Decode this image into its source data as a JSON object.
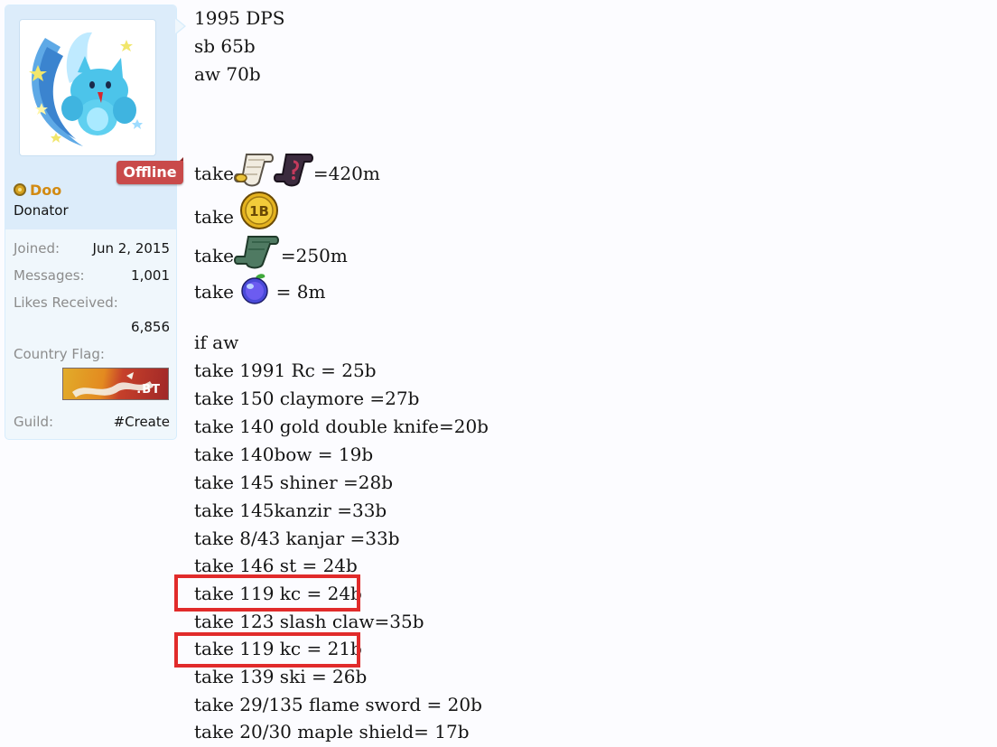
{
  "user": {
    "name": "Doo",
    "title": "Donator",
    "status": "Offline",
    "stats": [
      {
        "label": "Joined:",
        "value": "Jun 2, 2015"
      },
      {
        "label": "Messages:",
        "value": "1,001"
      },
      {
        "label": "Likes Received:",
        "value": "6,856"
      },
      {
        "label": "Country Flag:",
        "value": ".BT"
      },
      {
        "label": "Guild:",
        "value": "#Create"
      }
    ]
  },
  "post": {
    "header_lines": [
      "1995 DPS",
      "sb 65b",
      "aw 70b"
    ],
    "item_lines": [
      {
        "prefix": "take",
        "suffix": "=420m",
        "icons": [
          "white-scroll-icon",
          "dark-scroll-icon"
        ]
      },
      {
        "prefix": "take",
        "suffix": "",
        "icons": [
          "1b-coin-icon"
        ]
      },
      {
        "prefix": "take",
        "suffix": "=250m",
        "icons": [
          "green-scroll-icon"
        ]
      },
      {
        "prefix": "take",
        "suffix": "= 8m",
        "icons": [
          "blue-apple-icon"
        ]
      }
    ],
    "offer_lines": [
      "if aw",
      "take 1991 Rc = 25b",
      "take 150 claymore =27b",
      "take 140 gold double knife=20b",
      "take 140bow = 19b",
      "take 145 shiner =28b",
      "take 145kanzir =33b",
      "take 8/43 kanjar =33b",
      "take 146 st = 24b",
      "take 119 kc = 24b",
      "take 123 slash claw=35b",
      "take 119 kc = 21b",
      "take 139 ski = 26b",
      "take 29/135 flame sword = 20b",
      "take 20/30 maple shield= 17b"
    ],
    "highlight_color": "#e12b2b"
  }
}
